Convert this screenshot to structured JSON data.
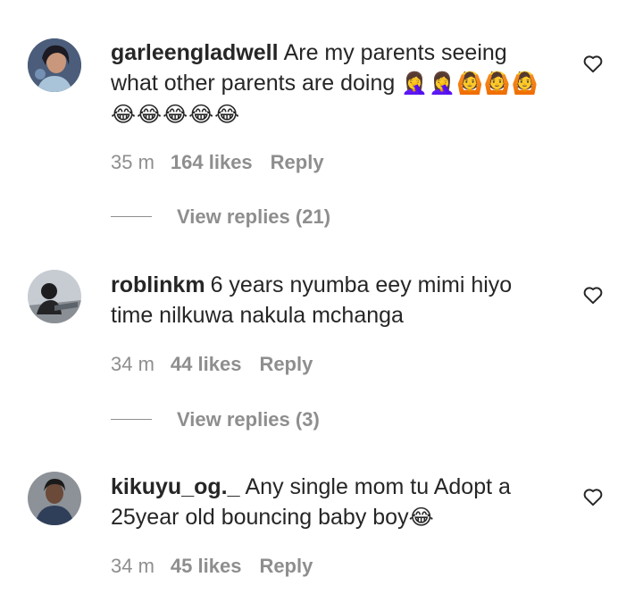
{
  "comments": [
    {
      "username": "garleengladwell",
      "text": "Are my parents seeing what other parents are doing",
      "emojis": "🤦‍♀️🤦‍♀️🙆🙆🙆 😂😂😂😂😂",
      "time": "35 m",
      "likes": "164 likes",
      "reply": "Reply",
      "view_replies": "View replies (21)"
    },
    {
      "username": "roblinkm",
      "text": "6 years nyumba eey mimi hiyo time nilkuwa nakula mchanga",
      "time": "34 m",
      "likes": "44 likes",
      "reply": "Reply",
      "view_replies": "View replies (3)"
    },
    {
      "username": "kikuyu_og._",
      "text": "Any single mom tu Adopt a 25year old bouncing baby boy",
      "emojis": "😂",
      "time": "34 m",
      "likes": "45 likes",
      "reply": "Reply"
    }
  ],
  "icons": {
    "like": "heart-outline-icon"
  },
  "colors": {
    "text": "#262626",
    "meta": "#8e8e8e"
  }
}
